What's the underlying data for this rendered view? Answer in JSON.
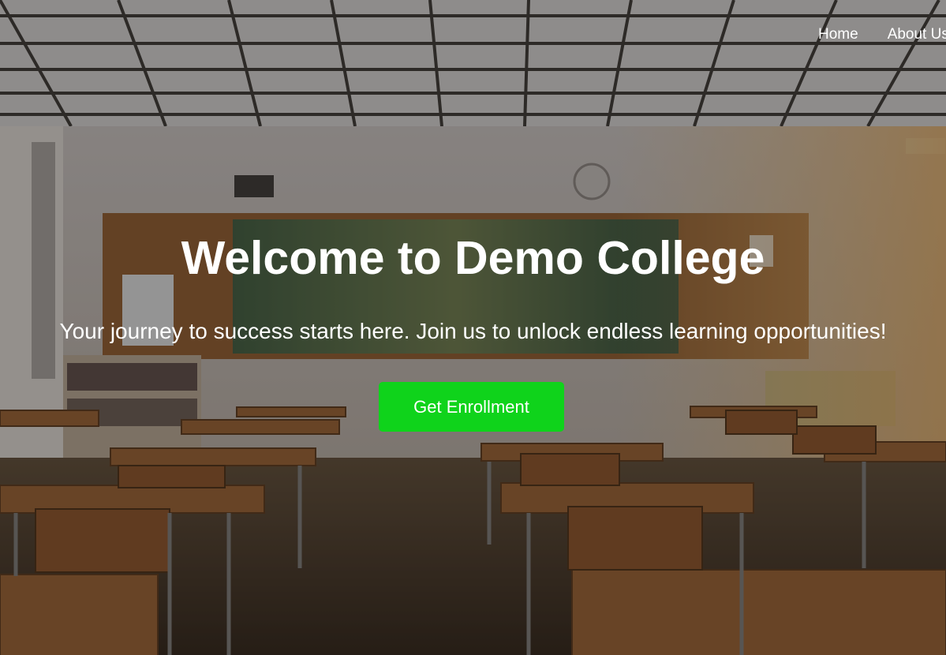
{
  "nav": {
    "items": [
      {
        "label": "Home"
      },
      {
        "label": "About Us"
      }
    ]
  },
  "hero": {
    "title": "Welcome to Demo College",
    "subtitle": "Your journey to success starts here. Join us to unlock endless learning opportunities!",
    "cta_label": "Get Enrollment"
  },
  "colors": {
    "cta_background": "#0fd31b",
    "text": "#ffffff",
    "overlay": "rgba(0,0,0,0.38)"
  }
}
